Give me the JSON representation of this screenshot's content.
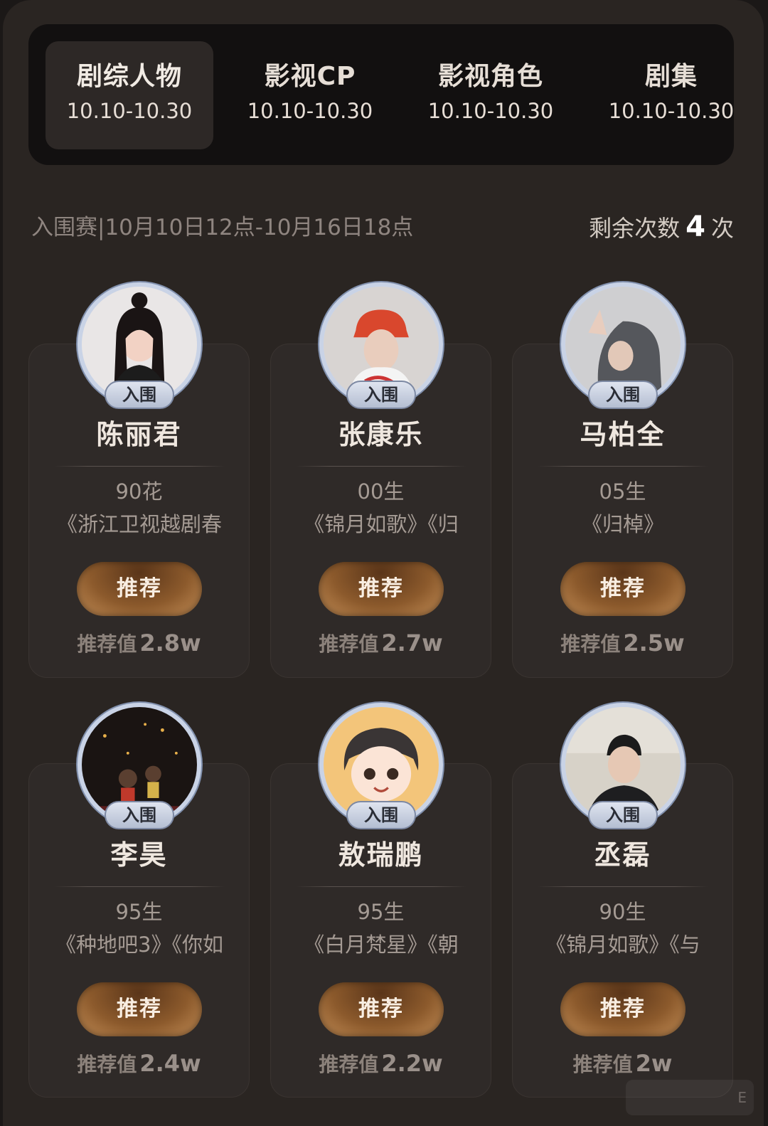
{
  "tabs": [
    {
      "title": "剧综人物",
      "date": "10.10-10.30",
      "active": true
    },
    {
      "title": "影视CP",
      "date": "10.10-10.30",
      "active": false
    },
    {
      "title": "影视角色",
      "date": "10.10-10.30",
      "active": false
    },
    {
      "title": "剧集",
      "date": "10.10-10.30",
      "active": false
    }
  ],
  "info": {
    "stage": "入围赛|10月10日12点-10月16日18点",
    "remaining_label": "剩余次数",
    "remaining_count": "4",
    "remaining_unit": "次"
  },
  "badge_label": "入围",
  "button_label": "推荐",
  "value_label": "推荐值",
  "cards": [
    {
      "name": "陈丽君",
      "tag": "90花",
      "works": "《浙江卫视越剧春",
      "value": "2.8w"
    },
    {
      "name": "张康乐",
      "tag": "00生",
      "works": "《锦月如歌》《归",
      "value": "2.7w"
    },
    {
      "name": "马柏全",
      "tag": "05生",
      "works": "《归棹》",
      "value": "2.5w"
    },
    {
      "name": "李昊",
      "tag": "95生",
      "works": "《种地吧3》《你如",
      "value": "2.4w"
    },
    {
      "name": "敖瑞鹏",
      "tag": "95生",
      "works": "《白月梵星》《朝",
      "value": "2.2w"
    },
    {
      "name": "丞磊",
      "tag": "90生",
      "works": "《锦月如歌》《与",
      "value": "2w"
    }
  ],
  "watermark": "E"
}
